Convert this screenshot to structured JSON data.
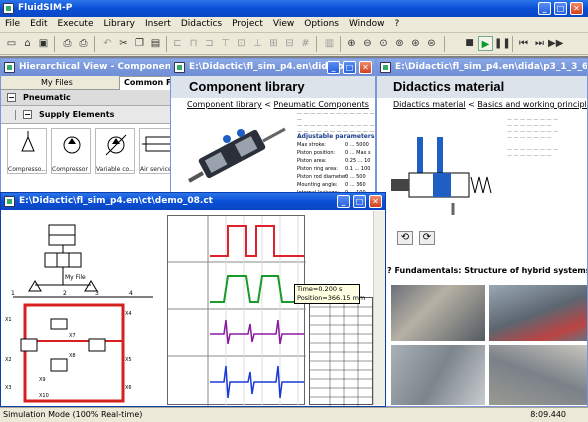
{
  "app": {
    "title": "FluidSIM-P"
  },
  "menu": [
    "File",
    "Edit",
    "Execute",
    "Library",
    "Insert",
    "Didactics",
    "Project",
    "View",
    "Options",
    "Window",
    "?"
  ],
  "toolbar_icons": [
    "new-file-icon",
    "open-file-icon",
    "save-icon",
    "print-preview-icon",
    "print-icon",
    "undo-icon",
    "cut-icon",
    "copy-icon",
    "paste-icon",
    "delete-icon",
    "align-left-icon",
    "align-center-icon",
    "align-right-icon",
    "align-top-icon",
    "align-middle-icon",
    "align-bottom-icon",
    "group-icon",
    "ungroup-icon",
    "grid-icon",
    "check-drawing-icon",
    "zoom-in-icon",
    "zoom-out-icon",
    "zoom-fit-icon",
    "zoom-window-icon",
    "zoom-previous-icon",
    "zoom-100-icon",
    "stop-icon",
    "start-icon",
    "pause-icon",
    "rewind-icon",
    "step-forward-icon",
    "fast-forward-icon"
  ],
  "windows": {
    "hierarchical": {
      "title": "Hierarchical View - Component Library",
      "tabs": [
        "My Files",
        "Common F"
      ],
      "groups": [
        "Pneumatic",
        "Supply Elements"
      ],
      "components": [
        "Compresso...",
        "Compressor",
        "Variable co...",
        "Air service"
      ]
    },
    "component_library": {
      "title": "E:\\Didactic\\fl_sim_p4.en\\dida\\p...",
      "heading": "Component library",
      "breadcrumb": [
        "Component library",
        "Pneumatic Components"
      ],
      "section": "Adjustable parameters",
      "params": [
        {
          "name": "Max stroke:",
          "value": "0 ... 5000"
        },
        {
          "name": "Piston position:",
          "value": "0 ... Max s"
        },
        {
          "name": "Piston area:",
          "value": "0.25 ... 10"
        },
        {
          "name": "Piston ring area:",
          "value": "0.1 ... 100"
        },
        {
          "name": "Piston rod diameter:",
          "value": "0 ... 500"
        },
        {
          "name": "Mounting angle:",
          "value": "0 ... 360"
        },
        {
          "name": "Internal leakage:",
          "value": "0 ... 100"
        }
      ]
    },
    "didactics": {
      "title": "E:\\Didactic\\fl_sim_p4.en\\dida\\p3_1_3_6.ct",
      "heading": "Didactics material",
      "breadcrumb": [
        "Didactics material",
        "Basics and working principles"
      ],
      "fundamentals": "Fundamentals: Structure of hybrid systems"
    },
    "demo": {
      "title": "E:\\Didactic\\fl_sim_p4.en\\ct\\demo_08.ct",
      "diagram_labels": [
        "My File",
        "1",
        "2",
        "3",
        "4",
        "X1",
        "X2",
        "X3",
        "X4",
        "X5",
        "X6",
        "X7",
        "X8",
        "X9",
        "X10"
      ],
      "tooltip": {
        "time": "Time=0.200 s",
        "position": "Position=366.15 mm"
      }
    }
  },
  "status": {
    "mode": "Simulation Mode (100% Real-time)",
    "time": "8:09.440"
  }
}
